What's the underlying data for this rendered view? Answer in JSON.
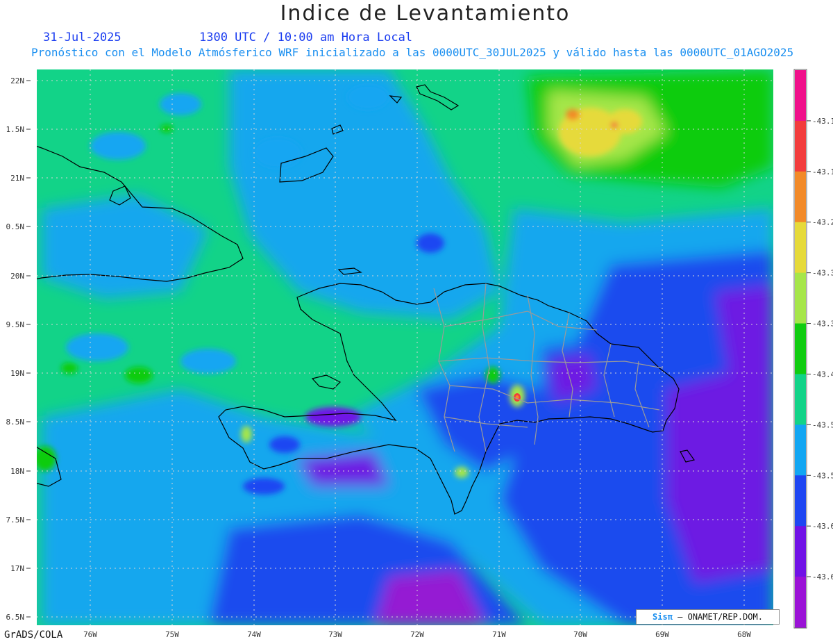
{
  "title": "Indice de Levantamiento",
  "date": "31-Jul-2025",
  "time": "1300 UTC / 10:00 am Hora Local",
  "subtitle": "Pronóstico con el Modelo Atmósferico WRF inicializado a las 0000UTC_30JUL2025 y válido hasta las  0000UTC_01AGO2025",
  "lat_labels": [
    "22N",
    "1.5N",
    "21N",
    "0.5N",
    "20N",
    "9.5N",
    "19N",
    "8.5N",
    "18N",
    "7.5N",
    "17N",
    "6.5N"
  ],
  "lon_labels": [
    "76W",
    "75W",
    "74W",
    "73W",
    "72W",
    "71W",
    "70W",
    "69W",
    "68W"
  ],
  "colorbar": {
    "colors": [
      "#f0108a",
      "#f23c3c",
      "#f28a28",
      "#e6da3a",
      "#a6e64a",
      "#10cc10",
      "#12d388",
      "#12a6f2",
      "#1e46f2",
      "#7012e6",
      "#9a12d6"
    ],
    "labels": [
      "-43.1",
      "-43.1",
      "-43.2",
      "-43.3",
      "-43.3",
      "-43.4",
      "-43.5",
      "-43.5",
      "-43.6",
      "-43.6"
    ]
  },
  "credit": {
    "sis": "Sisπ",
    "rest": "– ONAMET/REP.DOM."
  },
  "footer": "GrADS/COLA"
}
